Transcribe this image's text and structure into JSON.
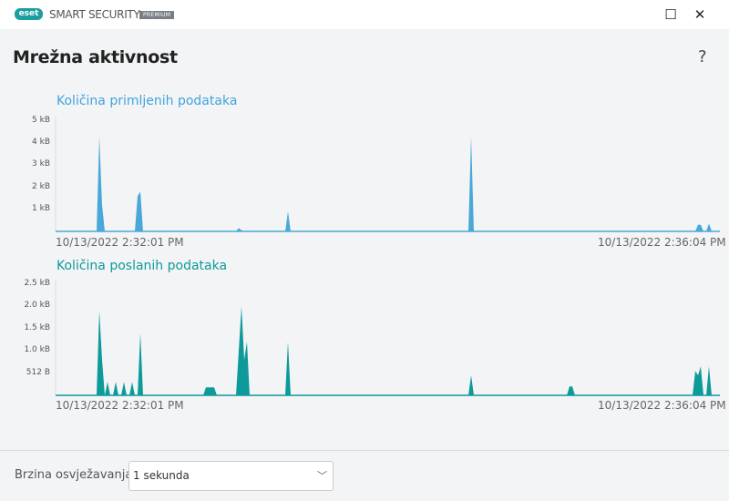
{
  "app": {
    "logo": "eset",
    "product": "SMART SECURITY",
    "edition": "PREMIUM"
  },
  "page": {
    "title": "Mrežna aktivnost",
    "help": "?"
  },
  "colors": {
    "received": "#4aa8d8",
    "sent": "#0e9a9a",
    "received_title": "#3fa3dc",
    "sent_title": "#0e9a9a"
  },
  "chart_data": [
    {
      "type": "area",
      "title": "Količina primljenih podataka",
      "yticks": [
        "5 kB",
        "4 kB",
        "3 kB",
        "2 kB",
        "1 kB"
      ],
      "ytick_values": [
        5,
        4,
        3,
        2,
        1
      ],
      "ylim": [
        0,
        5
      ],
      "xlim": [
        0,
        243
      ],
      "xunit": "seconds",
      "start": "10/13/2022 2:32:01 PM",
      "end": "10/13/2022 2:36:04 PM",
      "points": [
        [
          15,
          0
        ],
        [
          16,
          4.3
        ],
        [
          17,
          1.2
        ],
        [
          18,
          0
        ],
        [
          29,
          0
        ],
        [
          30,
          1.6
        ],
        [
          31,
          1.8
        ],
        [
          32,
          0
        ],
        [
          66,
          0
        ],
        [
          67,
          0.15
        ],
        [
          68,
          0.05
        ],
        [
          69,
          0
        ],
        [
          84,
          0
        ],
        [
          85,
          0.9
        ],
        [
          86,
          0
        ],
        [
          151,
          0
        ],
        [
          152,
          4.3
        ],
        [
          153,
          0
        ],
        [
          234,
          0
        ],
        [
          235,
          0.3
        ],
        [
          236,
          0.3
        ],
        [
          237,
          0
        ],
        [
          238,
          0
        ],
        [
          239,
          0.35
        ],
        [
          240,
          0
        ]
      ]
    },
    {
      "type": "area",
      "title": "Količina poslanih podataka",
      "yticks": [
        "2.5 kB",
        "2.0 kB",
        "1.5 kB",
        "1.0 kB",
        "512 B"
      ],
      "ytick_values": [
        2.5,
        2.0,
        1.5,
        1.0,
        0.5
      ],
      "ylim": [
        0,
        2.5
      ],
      "xlim": [
        0,
        243
      ],
      "xunit": "seconds",
      "start": "10/13/2022 2:32:01 PM",
      "end": "10/13/2022 2:36:04 PM",
      "points": [
        [
          15,
          0
        ],
        [
          16,
          1.9
        ],
        [
          17,
          0.8
        ],
        [
          18,
          0
        ],
        [
          19,
          0.3
        ],
        [
          20,
          0
        ],
        [
          21,
          0
        ],
        [
          22,
          0.3
        ],
        [
          23,
          0
        ],
        [
          24,
          0
        ],
        [
          25,
          0.3
        ],
        [
          26,
          0
        ],
        [
          27,
          0
        ],
        [
          28,
          0.3
        ],
        [
          29,
          0
        ],
        [
          30,
          0
        ],
        [
          31,
          1.4
        ],
        [
          32,
          0
        ],
        [
          54,
          0
        ],
        [
          55,
          0.18
        ],
        [
          58,
          0.18
        ],
        [
          59,
          0
        ],
        [
          66,
          0
        ],
        [
          68,
          2.0
        ],
        [
          69,
          0.8
        ],
        [
          70,
          1.2
        ],
        [
          71,
          0
        ],
        [
          84,
          0
        ],
        [
          85,
          1.2
        ],
        [
          86,
          0
        ],
        [
          151,
          0
        ],
        [
          152,
          0.45
        ],
        [
          153,
          0
        ],
        [
          187,
          0
        ],
        [
          188,
          0.2
        ],
        [
          189,
          0.2
        ],
        [
          190,
          0
        ],
        [
          233,
          0
        ],
        [
          234,
          0.55
        ],
        [
          235,
          0.45
        ],
        [
          236,
          0.65
        ],
        [
          237,
          0
        ],
        [
          238,
          0
        ],
        [
          239,
          0.65
        ],
        [
          240,
          0
        ]
      ]
    }
  ],
  "footer": {
    "label": "Brzina osvježavanja",
    "select_value": "1 sekunda"
  }
}
